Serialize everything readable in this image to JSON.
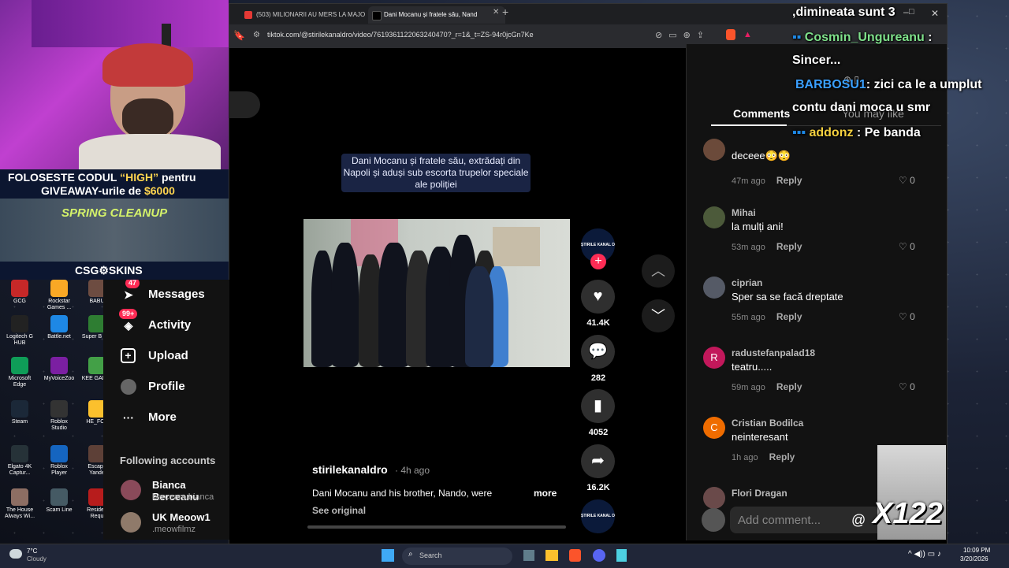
{
  "browser": {
    "tabs": [
      {
        "title": "(503) MILIONARII AU MERS LA MAJO"
      },
      {
        "title": "Dani Mocanu și fratele său, Nand"
      }
    ],
    "new_tab": "+",
    "url": "tiktok.com/@stirilekanaldro/video/7619361122063240470?_r=1&_t=ZS-94r0jcGn7Ke"
  },
  "overlay": {
    "promo_line1_a": "FOLOSESTE CODUL ",
    "promo_code": "“HIGH”",
    "promo_line1_b": " pentru",
    "promo_line2_a": "GIVEAWAY-urile de ",
    "promo_amount": "$6000",
    "banner_title": "SPRING CLEANUP",
    "brand": "CSG⚙SKINS",
    "counter": "X122"
  },
  "chat": [
    {
      "user": "",
      "text": ",dimineata sunt 3"
    },
    {
      "user": "Cosmin_Ungureanu",
      "text": ":"
    },
    {
      "user": "",
      "text": "Sincer..."
    },
    {
      "user": "BARBOSU1",
      "text": ": zici ca le a umplut"
    },
    {
      "user": "",
      "text": "contu dani moca u smr"
    },
    {
      "user": "addonz",
      "text": ": Pe banda"
    }
  ],
  "video": {
    "caption_overlay": "Dani Mocanu și fratele său, extrădați din Napoli și aduși sub escorta trupelor speciale ale poliției",
    "author": "stirilekanaldro",
    "age": "· 4h ago",
    "description": "Dani Mocanu and his brother, Nando, were",
    "more": "more",
    "see_original": "See original",
    "avatar_text": "ȘTIRILE KANAL D",
    "likes": "41.4K",
    "comments": "282",
    "saves": "4052",
    "shares": "16.2K"
  },
  "nav": {
    "messages": "Messages",
    "messages_badge": "47",
    "activity": "Activity",
    "activity_badge": "99+",
    "upload": "Upload",
    "profile": "Profile",
    "more": "More",
    "following_header": "Following accounts",
    "following": [
      {
        "name": "Bianca Berceanu",
        "handle": "berceanubianca"
      },
      {
        "name": "UK Meoow1",
        "handle": ".meowfilmz"
      }
    ]
  },
  "comments_panel": {
    "tab_comments": "Comments",
    "tab_you_may_like": "You may like",
    "comments": [
      {
        "user": "",
        "text": "deceee😳😳",
        "time": "47m ago",
        "reply": "Reply",
        "likes": "0",
        "avatar": "#6b4a3a"
      },
      {
        "user": "Mihai",
        "text": "la mulți ani!",
        "time": "53m ago",
        "reply": "Reply",
        "likes": "0",
        "avatar": "#4c5a3a"
      },
      {
        "user": "ciprian",
        "text": "Sper sa se facă dreptate",
        "time": "55m ago",
        "reply": "Reply",
        "likes": "0",
        "avatar": "#555a66"
      },
      {
        "user": "radustefanpalad18",
        "text": "teatru.....",
        "time": "59m ago",
        "reply": "Reply",
        "likes": "0",
        "avatar": "#c2185b",
        "initial": "R"
      },
      {
        "user": "Cristian Bodilca",
        "text": "neinteresant",
        "time": "1h ago",
        "reply": "Reply",
        "likes": "",
        "avatar": "#ef6c00",
        "initial": "C"
      },
      {
        "user": "Flori Dragan",
        "text": "",
        "time": "",
        "reply": "",
        "likes": "",
        "avatar": "#6a4a4a"
      }
    ],
    "add_comment_placeholder": "Add comment...",
    "at": "@"
  },
  "desktop_icons": [
    {
      "label": "GCG",
      "color": "#c62828"
    },
    {
      "label": "Rockstar Games ...",
      "color": "#f9a825"
    },
    {
      "label": "BABU",
      "color": "#6d4c41"
    },
    {
      "label": "Logitech G HUB",
      "color": "#222222"
    },
    {
      "label": "Battle.net",
      "color": "#1e88e5"
    },
    {
      "label": "Super B Gol",
      "color": "#2e7d32"
    },
    {
      "label": "Microsoft Edge",
      "color": "#0f9d58"
    },
    {
      "label": "MyVoiceZoo",
      "color": "#7b1fa2"
    },
    {
      "label": "KEE GAMBI",
      "color": "#43a047"
    },
    {
      "label": "Steam",
      "color": "#1b2838"
    },
    {
      "label": "Roblox Studio",
      "color": "#333333"
    },
    {
      "label": "HE_FOL",
      "color": "#fbc02d"
    },
    {
      "label": "Elgato 4K Captur...",
      "color": "#263238"
    },
    {
      "label": "Roblox Player",
      "color": "#1565c0"
    },
    {
      "label": "Escape Yande",
      "color": "#5d4037"
    },
    {
      "label": "The House Always Wi...",
      "color": "#8d6e63"
    },
    {
      "label": "Scam Line",
      "color": "#455a64"
    },
    {
      "label": "Residen Requ",
      "color": "#b71c1c"
    }
  ],
  "taskbar": {
    "temp": "7°C",
    "weather": "Cloudy",
    "search": "Search",
    "time": "10:09 PM",
    "date": "3/20/2026"
  }
}
